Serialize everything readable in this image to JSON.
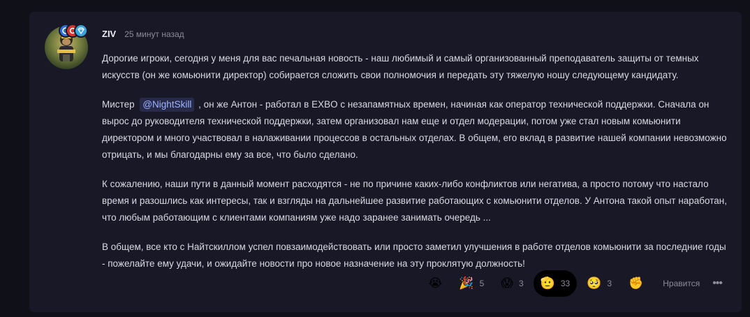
{
  "post": {
    "author": "ZIV",
    "time": "25 минут назад",
    "paragraphs": {
      "p1": "Дорогие игроки, сегодня у меня для вас печальная новость - наш любимый и самый организованный преподаватель защиты от темных искусств (он же комьюнити директор) собирается сложить свои полномочия и передать эту тяжелую ношу следующему кандидату.",
      "p2_before": "Мистер ",
      "p2_mention": "@NightSkill",
      "p2_after": " , он же Антон - работал в EXBO с незапамятных времен, начиная как оператор технической поддержки. Сначала он вырос до руководителя технической поддержки, затем организовал нам еще и отдел модерации, потом уже стал новым комьюнити директором и много участвовал в налаживании процессов в остальных отделах. В общем, его вклад в развитие нашей компании невозможно отрицать, и мы благодарны ему за все, что было сделано.",
      "p3": "К сожалению, наши пути в данный момент расходятся - не по причине каких-либо конфликтов или негатива, а просто потому что настало время и разошлись как интересы, так и взгляды на дальнейшее развитие работающих с комьюнити отделов. У Антона такой опыт наработан, что любым работающим с клиентами компаниям уже надо заранее занимать очередь ...",
      "p4": "В общем, все кто с Найтскиллом успел повзаимодействовать или просто заметил улучшения в работе отделов комьюнити за последние годы - пожелайте ему удачи, и ожидайте новости про новое назначение на эту проклятую должность!"
    }
  },
  "reactions": [
    {
      "emoji": "😭",
      "name": "crying-face",
      "count": ""
    },
    {
      "emoji": "🎉",
      "name": "party-popper",
      "count": "5"
    },
    {
      "emoji": "😱",
      "name": "screaming-face",
      "count": "3"
    },
    {
      "emoji": "🫡",
      "name": "saluting-face",
      "count": "33",
      "active": true
    },
    {
      "emoji": "🥺",
      "name": "pleading-face",
      "count": "3"
    },
    {
      "emoji": "✊",
      "name": "raised-fist",
      "count": ""
    }
  ],
  "actions": {
    "like_label": "Нравится",
    "more_label": "•••"
  },
  "colors": {
    "page_bg": "#101019",
    "card_bg": "#181826",
    "mention": "#9fb4ff",
    "active_reaction_bg": "#000000"
  }
}
